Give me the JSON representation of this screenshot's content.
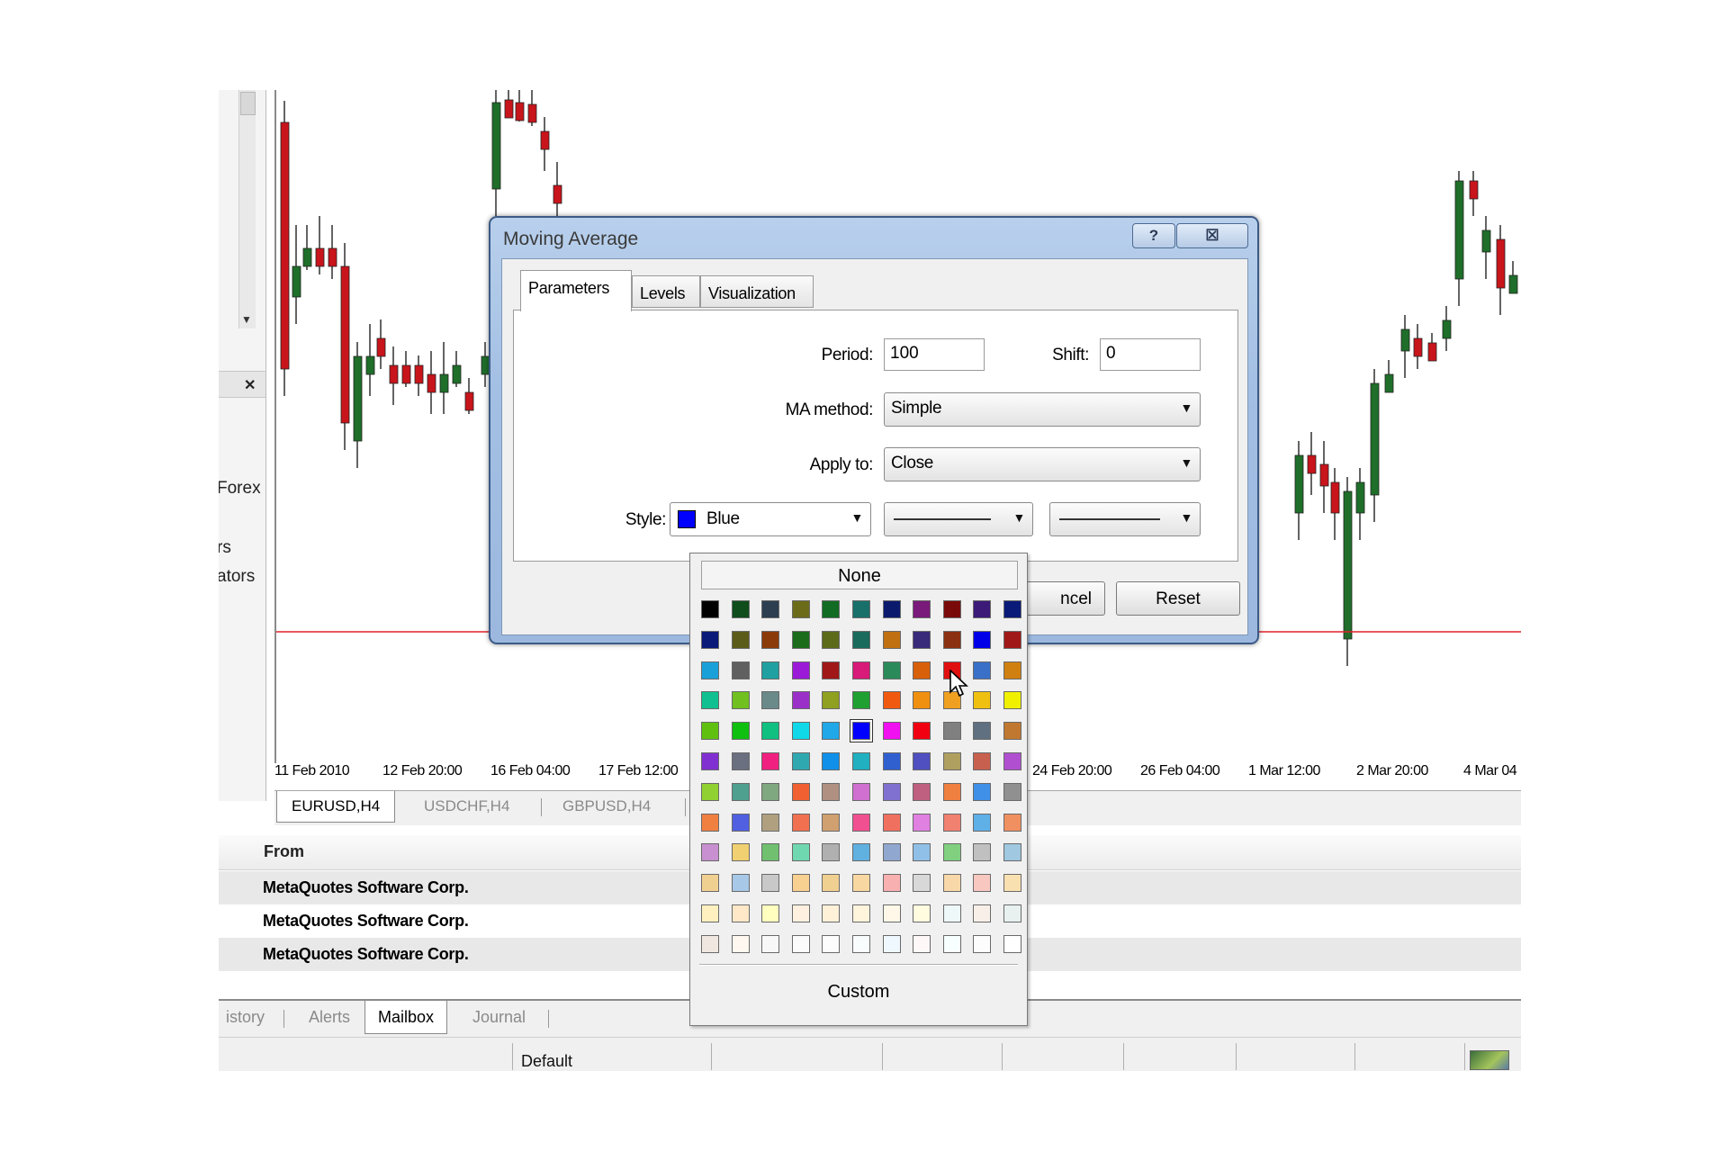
{
  "navigator": {
    "items": [
      "Forex",
      "rs",
      "ators"
    ]
  },
  "chart": {
    "x_labels": [
      "11 Feb 2010",
      "12 Feb 20:00",
      "16 Feb 04:00",
      "17 Feb 12:00",
      "24 Feb 20:00",
      "26 Feb 04:00",
      "1 Mar 12:00",
      "2 Mar 20:00",
      "4 Mar 04"
    ],
    "tabs": [
      "EURUSD,H4",
      "USDCHF,H4",
      "GBPUSD,H4"
    ],
    "bull_color": "#1f6e2a",
    "bear_color": "#c8141b",
    "level_line_color": "#e0202a"
  },
  "terminal": {
    "column_from": "From",
    "messages": [
      "MetaQuotes Software Corp.",
      "MetaQuotes Software Corp.",
      "MetaQuotes Software Corp."
    ],
    "tabs": [
      "istory",
      "Alerts",
      "Mailbox",
      "Journal"
    ],
    "active_tab": "Mailbox",
    "status_profile": "Default"
  },
  "dialog": {
    "title": "Moving Average",
    "help_label": "?",
    "close_label": "☒",
    "tabs": [
      "Parameters",
      "Levels",
      "Visualization"
    ],
    "active_tab": "Parameters",
    "period_label": "Period:",
    "period_value": "100",
    "shift_label": "Shift:",
    "shift_value": "0",
    "method_label": "MA method:",
    "method_value": "Simple",
    "apply_label": "Apply to:",
    "apply_value": "Close",
    "style_label": "Style:",
    "style_color_name": "Blue",
    "cancel_label": "ncel",
    "reset_label": "Reset"
  },
  "color_popup": {
    "none_label": "None",
    "custom_label": "Custom",
    "selected_color": "#0000ff",
    "rows": [
      [
        "#000000",
        "#0f4d1c",
        "#2c3e50",
        "#6b6b1a",
        "#116b23",
        "#19706b",
        "#0c1a6e",
        "#7a1a7a",
        "#7a0a0a",
        "#3b1a78",
        "#0a1a78"
      ],
      [
        "#0a1a78",
        "#5c5c1a",
        "#8b3a0a",
        "#1a6b1a",
        "#5c6b1a",
        "#1a6b5c",
        "#c07010",
        "#3a2a7a",
        "#8b3010",
        "#0000e8",
        "#a01818"
      ],
      [
        "#1aa0d8",
        "#606060",
        "#20a0a0",
        "#9b1ad8",
        "#a01818",
        "#d81a78",
        "#2a8a5a",
        "#d8600a",
        "#e01010",
        "#3a70c8",
        "#d08010"
      ],
      [
        "#10c090",
        "#70c020",
        "#6a8a8a",
        "#9b30c8",
        "#90a020",
        "#20a030",
        "#f05a10",
        "#f09010",
        "#f0a020",
        "#f0c010",
        "#f0f000"
      ],
      [
        "#60c010",
        "#10c010",
        "#10c080",
        "#10d8e8",
        "#20a8e8",
        "#0000ff",
        "#f010f0",
        "#f00010",
        "#808080",
        "#607080",
        "#c07830"
      ],
      [
        "#8030d0",
        "#6a7080",
        "#f02080",
        "#30a8b0",
        "#1090e8",
        "#20b0c0",
        "#3060d0",
        "#5050c0",
        "#b0a060",
        "#c86050",
        "#b050d0"
      ],
      [
        "#90d030",
        "#50a090",
        "#80a880",
        "#f06030",
        "#b09080",
        "#d070d0",
        "#8070d0",
        "#c06080",
        "#f08040",
        "#4090e8",
        "#909090"
      ],
      [
        "#f08040",
        "#5060e0",
        "#b0a080",
        "#f07050",
        "#d0a070",
        "#f05090",
        "#f07060",
        "#e080e0",
        "#f08070",
        "#60b0e8",
        "#f09060"
      ],
      [
        "#c890d0",
        "#f0d070",
        "#70c070",
        "#70d8b0",
        "#b0b0b0",
        "#60b0e0",
        "#90a8d0",
        "#90c0e8",
        "#80d080",
        "#c0c0c0",
        "#a0c8e0"
      ],
      [
        "#f0d090",
        "#a8c8e8",
        "#c8c8c8",
        "#f8d090",
        "#f0d090",
        "#f8d8a0",
        "#f8b0b0",
        "#d8d8d8",
        "#f8d8a8",
        "#f8c8c0",
        "#f8e0b0"
      ],
      [
        "#fff0c0",
        "#ffe8c8",
        "#ffffc0",
        "#fff0e0",
        "#fff0d8",
        "#fff4dc",
        "#fff8e8",
        "#fffce0",
        "#eef8f8",
        "#f8f0e8",
        "#e8f0f0"
      ],
      [
        "#f0e8e0",
        "#fff8f0",
        "#f8f8f8",
        "#fbfbfb",
        "#fcfcfc",
        "#f8fcfc",
        "#f0f8ff",
        "#fff8f8",
        "#f8ffff",
        "#fdfdfd",
        "#ffffff"
      ]
    ]
  }
}
